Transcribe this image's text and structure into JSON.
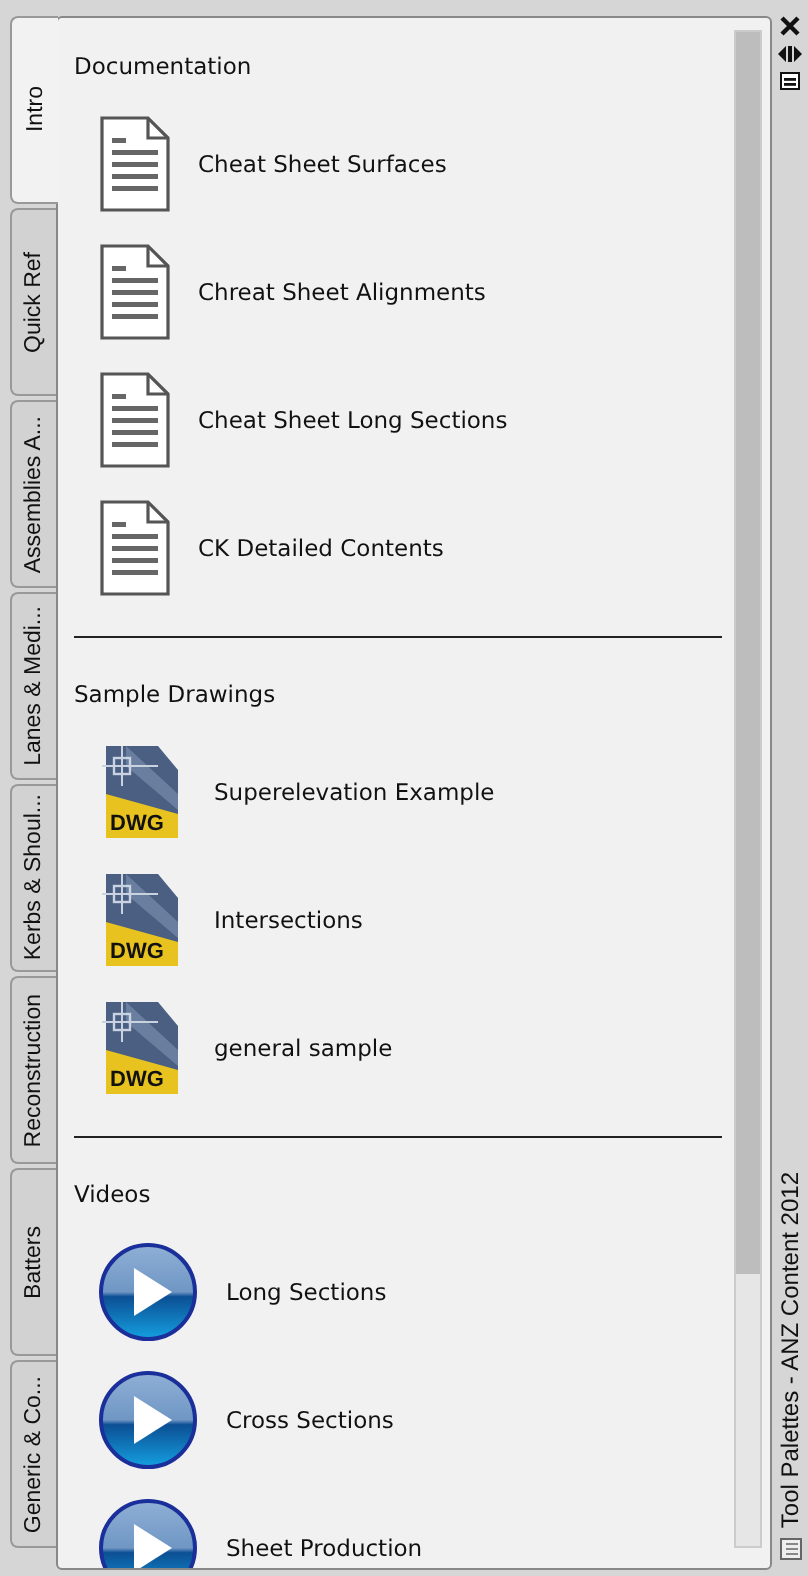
{
  "tabs": [
    {
      "label": "Intro",
      "selected": true
    },
    {
      "label": "Quick Ref",
      "selected": false
    },
    {
      "label": "Assemblies A...",
      "selected": false
    },
    {
      "label": "Lanes & Medi...",
      "selected": false
    },
    {
      "label": "Kerbs & Shoul...",
      "selected": false
    },
    {
      "label": "Reconstruction",
      "selected": false
    },
    {
      "label": "Batters",
      "selected": false
    },
    {
      "label": "Generic & Co...",
      "selected": false
    }
  ],
  "sections": [
    {
      "title": "Documentation",
      "items": [
        {
          "kind": "document",
          "label": "Cheat Sheet Surfaces"
        },
        {
          "kind": "document",
          "label": "Chreat Sheet Alignments"
        },
        {
          "kind": "document",
          "label": "Cheat Sheet Long Sections"
        },
        {
          "kind": "document",
          "label": "CK Detailed Contents"
        }
      ]
    },
    {
      "title": "Sample Drawings",
      "items": [
        {
          "kind": "drawing",
          "label": "Superelevation Example",
          "badge": "DWG"
        },
        {
          "kind": "drawing",
          "label": "Intersections",
          "badge": "DWG"
        },
        {
          "kind": "drawing",
          "label": "general sample",
          "badge": "DWG"
        }
      ]
    },
    {
      "title": "Videos",
      "items": [
        {
          "kind": "video",
          "label": "Long Sections"
        },
        {
          "kind": "video",
          "label": "Cross Sections"
        },
        {
          "kind": "video",
          "label": "Sheet Production"
        }
      ]
    }
  ],
  "title_bar": {
    "title": "Tool Palettes - ANZ Content 2012"
  }
}
